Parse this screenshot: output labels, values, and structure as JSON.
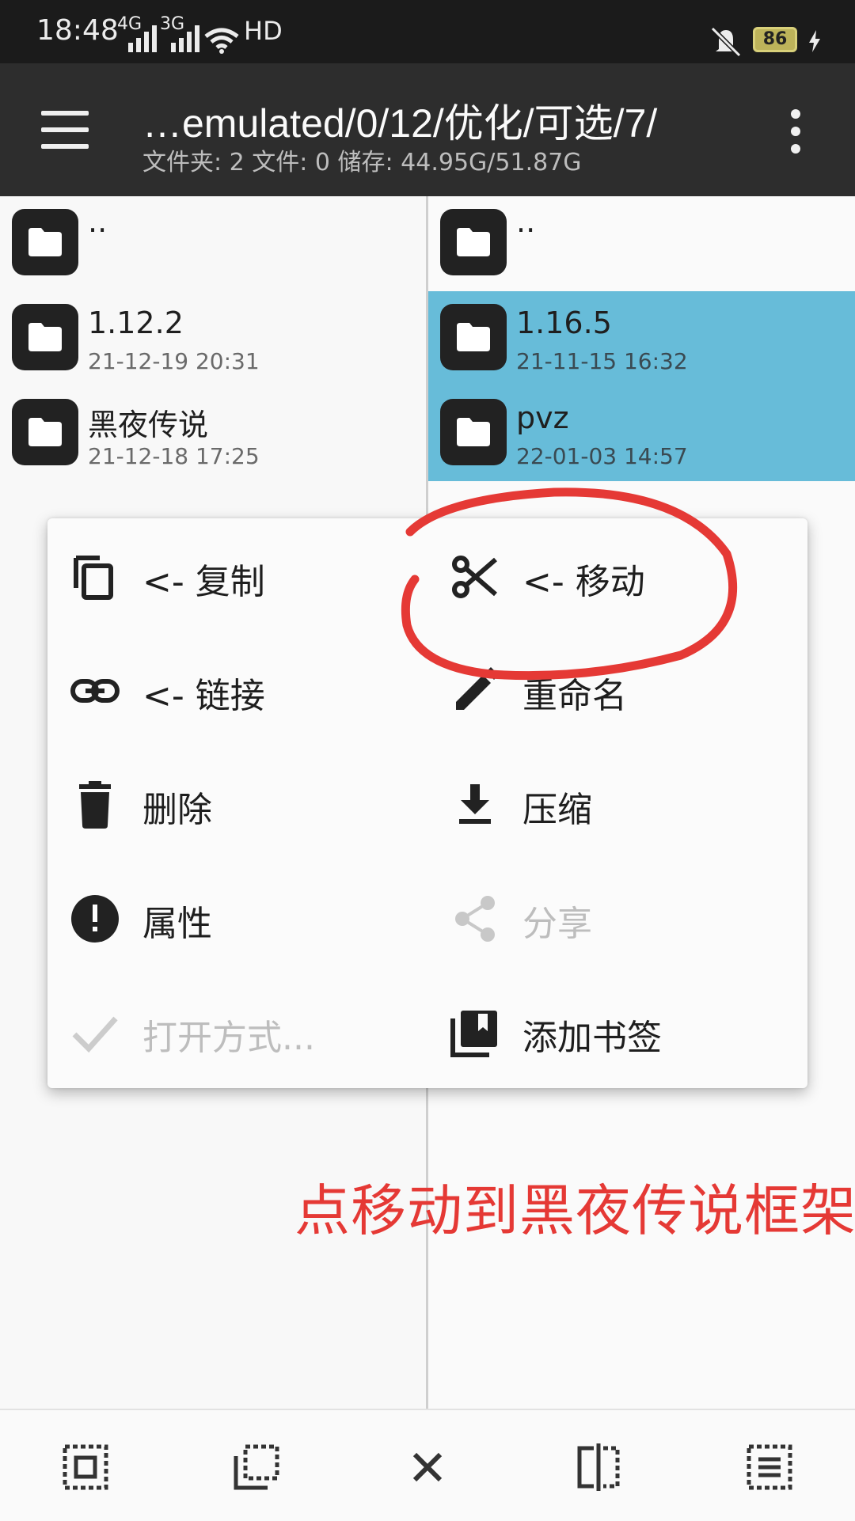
{
  "status_bar": {
    "time": "18:48",
    "signal1": "4G",
    "signal2": "3G",
    "network": "HD",
    "battery_level": "86"
  },
  "toolbar": {
    "path": "…emulated/0/12/优化/可选/7/",
    "summary": "文件夹: 2  文件: 0  储存: 44.95G/51.87G"
  },
  "left_pane": {
    "items": [
      {
        "name": "..",
        "date": ""
      },
      {
        "name": "1.12.2",
        "date": "21-12-19 20:31"
      },
      {
        "name": "黑夜传说",
        "date": "21-12-18 17:25"
      }
    ]
  },
  "right_pane": {
    "items": [
      {
        "name": "..",
        "date": "",
        "selected": false
      },
      {
        "name": "1.16.5",
        "date": "21-11-15 16:32",
        "selected": true
      },
      {
        "name": "pvz",
        "date": "22-01-03 14:57",
        "selected": true
      }
    ],
    "selected_color": "#67bcd9"
  },
  "context_menu": {
    "items": [
      {
        "label": "<- 复制",
        "icon": "copy-icon",
        "enabled": true
      },
      {
        "label": "<- 移动",
        "icon": "scissors-icon",
        "enabled": true
      },
      {
        "label": "<- 链接",
        "icon": "link-icon",
        "enabled": true
      },
      {
        "label": "重命名",
        "icon": "pencil-icon",
        "enabled": true
      },
      {
        "label": "删除",
        "icon": "trash-icon",
        "enabled": true
      },
      {
        "label": "压缩",
        "icon": "download-icon",
        "enabled": true
      },
      {
        "label": "属性",
        "icon": "info-icon",
        "enabled": true
      },
      {
        "label": "分享",
        "icon": "share-icon",
        "enabled": false
      },
      {
        "label": "打开方式...",
        "icon": "check-icon",
        "enabled": false
      },
      {
        "label": "添加书签",
        "icon": "bookmark-icon",
        "enabled": true
      }
    ]
  },
  "annotation": {
    "text": "点移动到黑夜传说框架",
    "color": "#e53935"
  },
  "bottom_bar": {
    "icons": [
      "select-all-icon",
      "select-inverse-icon",
      "close-icon",
      "split-view-icon",
      "list-view-icon"
    ]
  }
}
